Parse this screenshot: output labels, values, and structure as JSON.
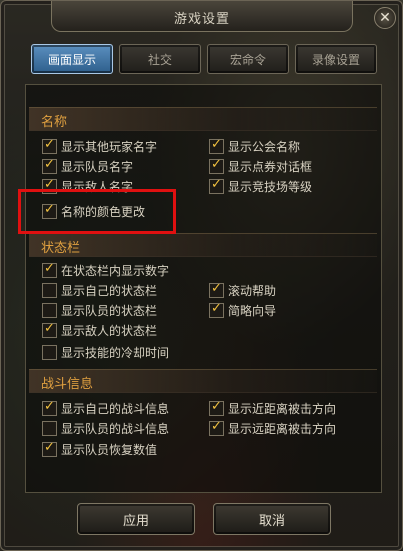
{
  "dialog": {
    "title": "游戏设置",
    "close_glyph": "✕"
  },
  "tabs": [
    {
      "label": "画面显示",
      "active": true
    },
    {
      "label": "社交",
      "active": false
    },
    {
      "label": "宏命令",
      "active": false
    },
    {
      "label": "录像设置",
      "active": false
    }
  ],
  "sections": {
    "names": {
      "header": "名称",
      "options": [
        {
          "label": "显示其他玩家名字",
          "checked": true
        },
        {
          "label": "显示队员名字",
          "checked": true
        },
        {
          "label": "显示敌人名字",
          "checked": true
        },
        {
          "label": "名称的颜色更改",
          "checked": true
        },
        {
          "label": "显示公会名称",
          "checked": true
        },
        {
          "label": "显示点券对话框",
          "checked": true
        },
        {
          "label": "显示竞技场等级",
          "checked": true
        }
      ]
    },
    "status": {
      "header": "状态栏",
      "options": [
        {
          "label": "在状态栏内显示数字",
          "checked": true
        },
        {
          "label": "显示自己的状态栏",
          "checked": false
        },
        {
          "label": "显示队员的状态栏",
          "checked": false
        },
        {
          "label": "显示敌人的状态栏",
          "checked": true
        },
        {
          "label": "显示技能的冷却时间",
          "checked": false
        },
        {
          "label": "滚动帮助",
          "checked": true
        },
        {
          "label": "简略向导",
          "checked": true
        }
      ]
    },
    "combat": {
      "header": "战斗信息",
      "options": [
        {
          "label": "显示自己的战斗信息",
          "checked": true
        },
        {
          "label": "显示队员的战斗信息",
          "checked": false
        },
        {
          "label": "显示队员恢复数值",
          "checked": true
        },
        {
          "label": "显示近距离被击方向",
          "checked": true
        },
        {
          "label": "显示远距离被击方向",
          "checked": true
        }
      ]
    }
  },
  "buttons": {
    "apply": "应用",
    "cancel": "取消"
  },
  "checkbox_tick": "✓",
  "colors": {
    "section_header": "#e0a040",
    "active_tab": "#3f79ad",
    "highlight_box": "#e01010",
    "checkmark": "#f0c040"
  }
}
